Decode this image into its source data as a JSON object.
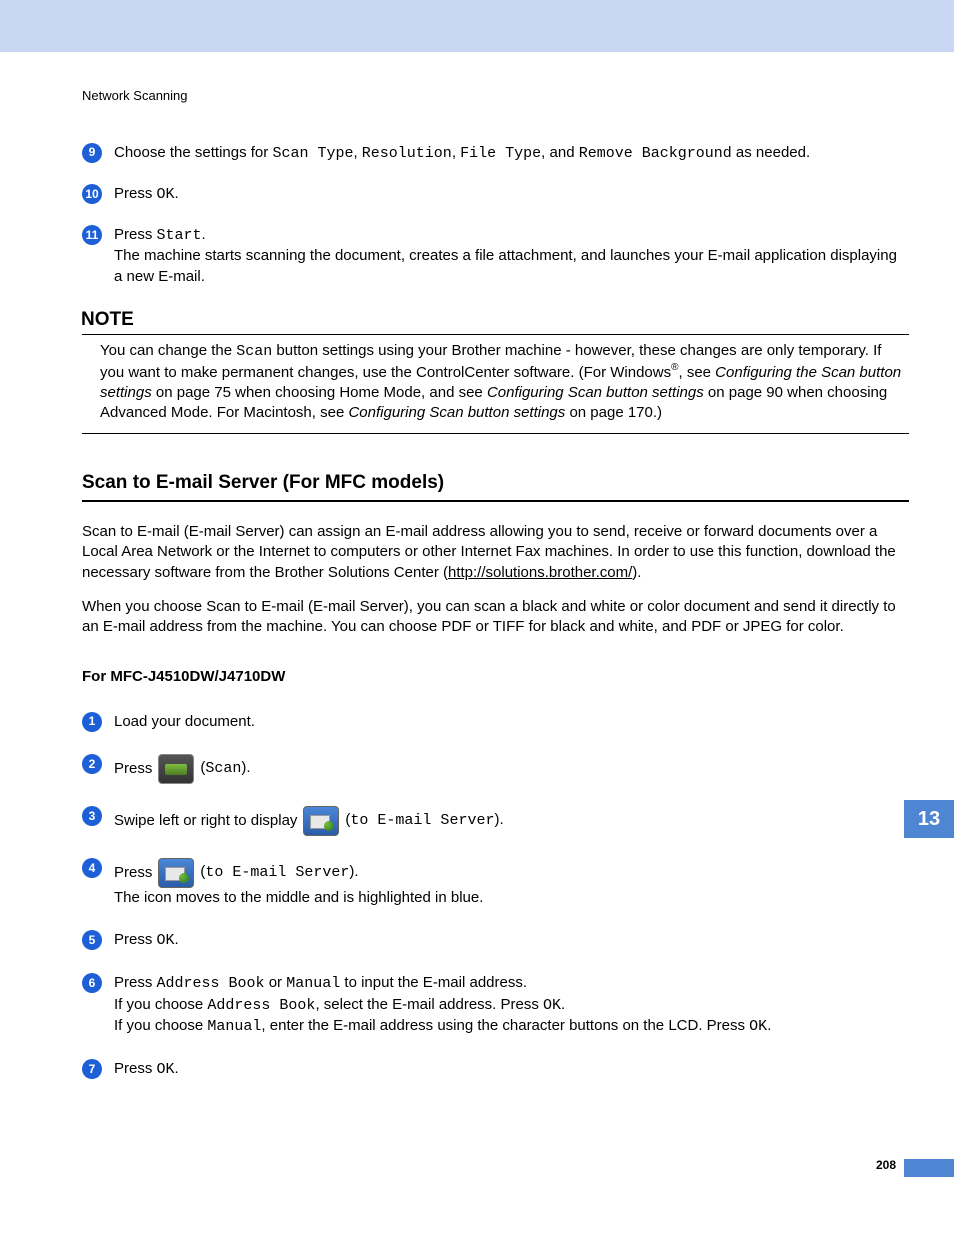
{
  "header": {
    "chapter": "Network Scanning"
  },
  "sideTab": "13",
  "pageNumber": "208",
  "steps1": {
    "s9": {
      "num": "9",
      "t1": "Choose the settings for ",
      "m1": "Scan Type",
      "c1": ", ",
      "m2": "Resolution",
      "c2": ", ",
      "m3": "File Type",
      "c3": ", and ",
      "m4": "Remove Background",
      "t2": " as needed."
    },
    "s10": {
      "num": "10",
      "t1": "Press ",
      "m1": "OK",
      "t2": "."
    },
    "s11": {
      "num": "11",
      "t1": "Press ",
      "m1": "Start",
      "t2": ".",
      "body": "The machine starts scanning the document, creates a file attachment, and launches your E-mail application displaying a new E-mail."
    }
  },
  "note": {
    "title": "NOTE",
    "p1a": "You can change the ",
    "p1m": "Scan",
    "p1b": " button settings using your Brother machine - however, these changes are only temporary. If you want to make permanent changes, use the ControlCenter software. (For Windows",
    "sup": "®",
    "p1c": ", see ",
    "i1": "Configuring the Scan button settings",
    "p1d": " on page 75 when choosing Home Mode, and see ",
    "i2": "Configuring Scan button settings",
    "p1e": " on page 90 when choosing Advanced Mode. For Macintosh, see ",
    "i3": "Configuring Scan button settings",
    "p1f": " on page 170.)"
  },
  "section": {
    "title": "Scan to E-mail Server (For MFC models)",
    "p1a": "Scan to E-mail (E-mail Server) can assign an E-mail address allowing you to send, receive or forward documents over a Local Area Network or the Internet to computers or other Internet Fax machines. In order to use this function, download the necessary software from the Brother Solutions Center (",
    "link": "http://solutions.brother.com/",
    "p1b": ").",
    "p2": "When you choose Scan to E-mail (E-mail Server), you can scan a black and white or color document and send it directly to an E-mail address from the machine. You can choose PDF or TIFF for black and white, and PDF or JPEG for color.",
    "sub": "For MFC-J4510DW/J4710DW"
  },
  "steps2": {
    "s1": {
      "num": "1",
      "text": "Load your document."
    },
    "s2": {
      "num": "2",
      "t1": "Press ",
      "m1": "Scan",
      "t2": ").",
      "open": "("
    },
    "s3": {
      "num": "3",
      "t1": "Swipe left or right to display ",
      "open": "(",
      "m1": "to E-mail Server",
      "t2": ")."
    },
    "s4": {
      "num": "4",
      "t1": "Press ",
      "open": "(",
      "m1": "to E-mail Server",
      "t2": ").",
      "body": "The icon moves to the middle and is highlighted in blue."
    },
    "s5": {
      "num": "5",
      "t1": "Press ",
      "m1": "OK",
      "t2": "."
    },
    "s6": {
      "num": "6",
      "t1": "Press ",
      "m1": "Address Book",
      "t2": " or ",
      "m2": "Manual",
      "t3": " to input the E-mail address.",
      "l2a": "If you choose ",
      "l2m": "Address Book",
      "l2b": ", select the E-mail address. Press ",
      "l2m2": "OK",
      "l2c": ".",
      "l3a": "If you choose ",
      "l3m": "Manual",
      "l3b": ", enter the E-mail address using the character buttons on the LCD. Press ",
      "l3m2": "OK",
      "l3c": "."
    },
    "s7": {
      "num": "7",
      "t1": "Press ",
      "m1": "OK",
      "t2": "."
    }
  }
}
